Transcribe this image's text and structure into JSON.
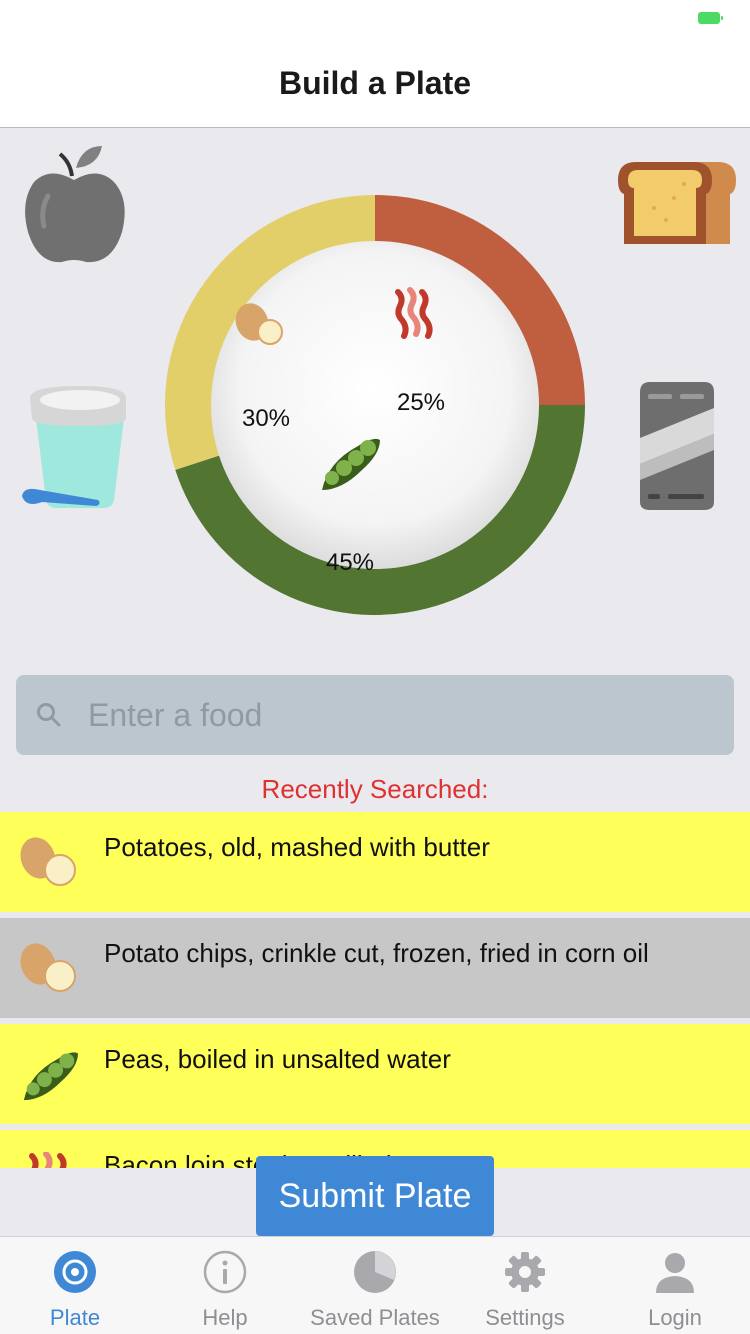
{
  "header": {
    "title": "Build a Plate"
  },
  "colors": {
    "accent": "#3f88d6",
    "potato_segment": "#e2cf6a",
    "bacon_segment": "#c05f40",
    "peas_segment": "#527531",
    "recent_heading": "#e03131",
    "item_highlight": "#ffff59",
    "item_selected": "#c7c7c7"
  },
  "food_groups": [
    {
      "icon": "apple-icon"
    },
    {
      "icon": "bread-icon"
    },
    {
      "icon": "yogurt-icon"
    },
    {
      "icon": "drink-can-icon"
    }
  ],
  "chart_data": {
    "type": "pie",
    "style": "donut",
    "slices": [
      {
        "name": "Bacon",
        "icon": "bacon-icon",
        "value": 25,
        "label": "25%"
      },
      {
        "name": "Peas",
        "icon": "peas-icon",
        "value": 45,
        "label": "45%"
      },
      {
        "name": "Potato",
        "icon": "potato-icon",
        "value": 30,
        "label": "30%"
      }
    ]
  },
  "search": {
    "placeholder": "Enter a food",
    "value": ""
  },
  "recent": {
    "heading": "Recently Searched:",
    "items": [
      {
        "label": "Potatoes, old, mashed with butter",
        "icon": "potato-icon"
      },
      {
        "label": "Potato chips, crinkle cut, frozen, fried in corn oil",
        "icon": "potato-icon"
      },
      {
        "label": "Peas, boiled in unsalted water",
        "icon": "peas-icon"
      },
      {
        "label": "Bacon loin steaks, grilled",
        "icon": "bacon-icon"
      }
    ]
  },
  "submit": {
    "label": "Submit Plate"
  },
  "tabs": [
    {
      "label": "Plate",
      "icon": "plate-target-icon",
      "active": true
    },
    {
      "label": "Help",
      "icon": "info-icon"
    },
    {
      "label": "Saved Plates",
      "icon": "pie-chart-icon"
    },
    {
      "label": "Settings",
      "icon": "gear-icon"
    },
    {
      "label": "Login",
      "icon": "user-icon"
    }
  ]
}
